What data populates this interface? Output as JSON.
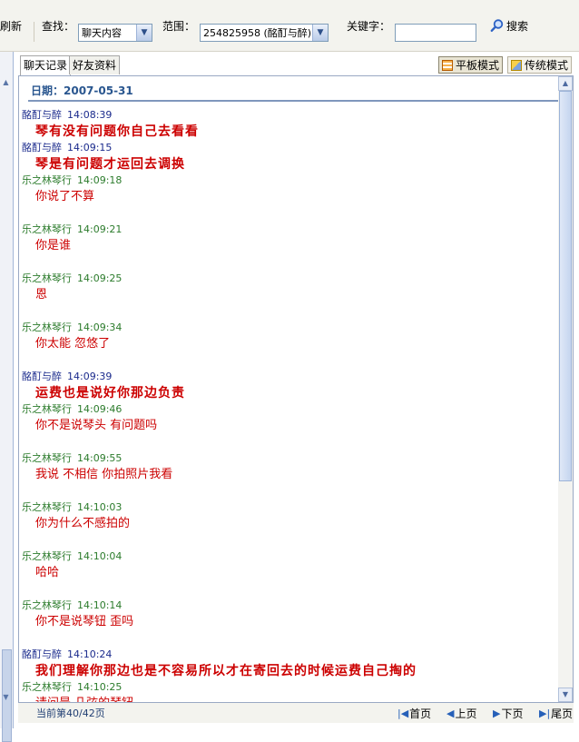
{
  "toolbar": {
    "refresh_label": "刷新",
    "find_label": "查找：",
    "find_value": "聊天内容",
    "range_label": "范围：",
    "range_value": "254825958 (酩酊与醉)",
    "keyword_label": "关键字：",
    "keyword_value": "",
    "search_label": "搜索"
  },
  "tabs": [
    {
      "label": "聊天记录",
      "active": true
    },
    {
      "label": "好友资料",
      "active": false
    }
  ],
  "modes": {
    "flat": "平板模式",
    "traditional": "传统模式"
  },
  "date_label": "日期：2007-05-31",
  "messages": [
    {
      "sender": "酩酊与醉",
      "time": "14:08:39",
      "text": "琴有没有问题你自己去看看",
      "mine": true
    },
    {
      "sender": "酩酊与醉",
      "time": "14:09:15",
      "text": "琴是有问题才运回去调换",
      "mine": true
    },
    {
      "sender": "乐之林琴行",
      "time": "14:09:18",
      "text": "你说了不算",
      "mine": false
    },
    {
      "sender": "乐之林琴行",
      "time": "14:09:21",
      "text": "你是谁",
      "mine": false
    },
    {
      "sender": "乐之林琴行",
      "time": "14:09:25",
      "text": "恩",
      "mine": false
    },
    {
      "sender": "乐之林琴行",
      "time": "14:09:34",
      "text": "你太能  忽悠了",
      "mine": false
    },
    {
      "sender": "酩酊与醉",
      "time": "14:09:39",
      "text": "运费也是说好你那边负责",
      "mine": true
    },
    {
      "sender": "乐之林琴行",
      "time": "14:09:46",
      "text": "你不是说琴头  有问题吗",
      "mine": false
    },
    {
      "sender": "乐之林琴行",
      "time": "14:09:55",
      "text": "我说  不相信  你拍照片我看",
      "mine": false
    },
    {
      "sender": "乐之林琴行",
      "time": "14:10:03",
      "text": "你为什么不感拍的",
      "mine": false
    },
    {
      "sender": "乐之林琴行",
      "time": "14:10:04",
      "text": "哈哈",
      "mine": false
    },
    {
      "sender": "乐之林琴行",
      "time": "14:10:14",
      "text": "你不是说琴钮  歪吗",
      "mine": false
    },
    {
      "sender": "酩酊与醉",
      "time": "14:10:24",
      "text": "我们理解你那边也是不容易所以才在寄回去的时候运费自己掏的",
      "mine": true
    },
    {
      "sender": "乐之林琴行",
      "time": "14:10:25",
      "text": "请问是  几弦的琴钮",
      "mine": false
    }
  ],
  "status": {
    "page_label": "当前第40/42页",
    "first": "首页",
    "prev": "上页",
    "next": "下页",
    "last": "尾页"
  },
  "colors": {
    "self_name": "#1a2a8c",
    "other_name": "#2b7b2b",
    "message_text": "#cc0000",
    "date_text": "#29568f"
  }
}
